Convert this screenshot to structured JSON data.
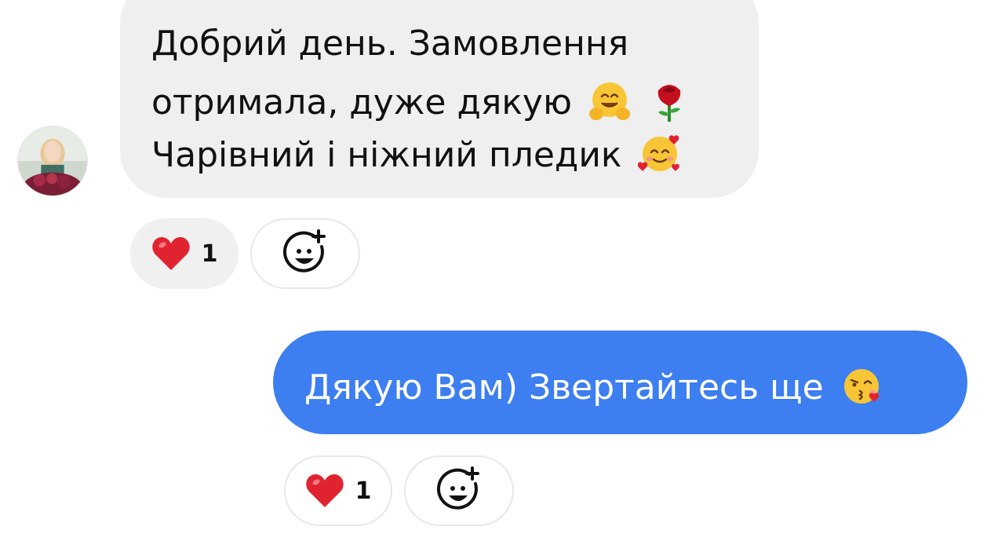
{
  "conversation": {
    "incoming": {
      "lines": [
        "Добрий день. Замовлення",
        "отримала, дуже дякую",
        "Чарівний і ніжний пледик"
      ],
      "emojis": [
        "hugging-face",
        "rose",
        "smiling-face-with-hearts"
      ],
      "reaction": {
        "icon": "heart",
        "count": "1"
      }
    },
    "outgoing": {
      "text": "Дякую Вам) Звертайтесь ще",
      "emoji": "face-blowing-kiss",
      "reaction": {
        "icon": "heart",
        "count": "1"
      }
    }
  },
  "colors": {
    "incoming_bubble": "#efefef",
    "outgoing_bubble": "#3d7ef0",
    "reaction_pill": "#f0f0f0",
    "heart": "#e0242f"
  }
}
